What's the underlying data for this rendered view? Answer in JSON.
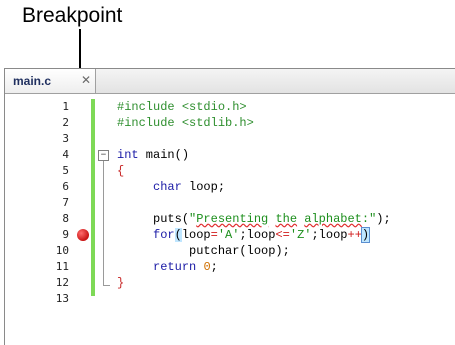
{
  "callout": {
    "label": "Breakpoint"
  },
  "tab": {
    "label": "main.c",
    "close_glyph": "✕"
  },
  "fold": {
    "collapse_glyph": "−"
  },
  "gutter": {
    "line_numbers": [
      "1",
      "2",
      "3",
      "4",
      "5",
      "6",
      "7",
      "8",
      "9",
      "10",
      "11",
      "12",
      "13"
    ],
    "breakpoint_line": 9
  },
  "colors": {
    "breakpoint": "#d81c1c",
    "modified_bar": "#7ed957",
    "preprocessor": "#2f8f2f",
    "keyword": "#1a1aa6",
    "string": "#1d8f1d",
    "number": "#d07000",
    "operator": "#d01a1a"
  },
  "code": {
    "l1_directive": "#include",
    "l1_header": "<stdio.h>",
    "l2_directive": "#include",
    "l2_header": "<stdlib.h>",
    "l4_type": "int",
    "l4_rest": " main()",
    "l5_brace": "{",
    "l6_indent": "     ",
    "l6_type": "char",
    "l6_rest": " loop;",
    "l8_indent": "     ",
    "l8_func": "puts(",
    "l8_q1": "\"",
    "l8_w1": "Presenting",
    "l8_s1": " ",
    "l8_w2": "the",
    "l8_s2": " ",
    "l8_w3": "alphabet",
    "l8_q2": ":\"",
    "l8_end": ");",
    "l9_indent": "     ",
    "l9_kw": "for",
    "l9_paren": "(",
    "l9_a": "loop",
    "l9_eq": "=",
    "l9_charA": "'A'",
    "l9_b": ";loop",
    "l9_le": "<=",
    "l9_charZ": "'Z'",
    "l9_c": ";loop",
    "l9_inc": "++",
    "l9_rparen": ")",
    "l10_indent": "          ",
    "l10_text": "putchar(loop);",
    "l11_indent": "     ",
    "l11_kw": "return",
    "l11_sp": " ",
    "l11_num": "0",
    "l11_semi": ";",
    "l12_brace": "}"
  }
}
